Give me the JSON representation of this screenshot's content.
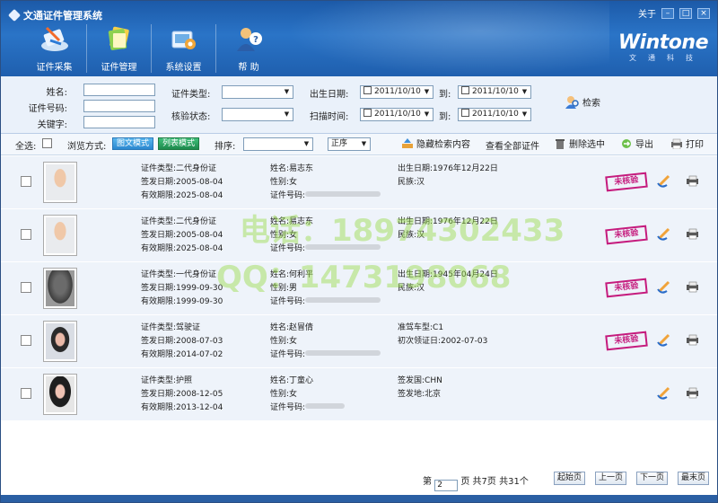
{
  "app": {
    "title": "文通证件管理系统",
    "about": "关于",
    "logo": "Wintone",
    "logo_sub": "文通科技"
  },
  "toolbar": {
    "items": [
      {
        "label": "证件采集",
        "icon": "scanner-icon"
      },
      {
        "label": "证件管理",
        "icon": "documents-icon"
      },
      {
        "label": "系统设置",
        "icon": "settings-icon"
      },
      {
        "label": "帮 助",
        "icon": "help-user-icon"
      }
    ]
  },
  "search": {
    "name_label": "姓名:",
    "idno_label": "证件号码:",
    "keyword_label": "关键字:",
    "type_label": "证件类型:",
    "verify_label": "核验状态:",
    "birth_label": "出生日期:",
    "scan_label": "扫描时间:",
    "to": "到:",
    "birth_from": "2011/10/10",
    "birth_to": "2011/10/10",
    "scan_from": "2011/10/10",
    "scan_to": "2011/10/10",
    "search_button": "检索"
  },
  "listbar": {
    "select_all": "全选:",
    "view_mode": "浏览方式:",
    "image_mode": "图文模式",
    "list_mode": "列表模式",
    "sort": "排序:",
    "order": "正序",
    "hide_search": "隐藏检索内容",
    "view_all": "查看全部证件",
    "delete_selected": "删除选中",
    "export": "导出",
    "print": "打印"
  },
  "records": [
    {
      "col1": [
        "证件类型:二代身份证",
        "签发日期:2005-08-04",
        "有效期限:2025-08-04"
      ],
      "col2": [
        "姓名:易志东",
        "性别:女",
        "证件号码:"
      ],
      "col3": [
        "出生日期:1976年12月22日",
        "民族:汉"
      ],
      "status": "未核验",
      "photo": "light"
    },
    {
      "col1": [
        "证件类型:二代身份证",
        "签发日期:2005-08-04",
        "有效期限:2025-08-04"
      ],
      "col2": [
        "姓名:易志东",
        "性别:女",
        "证件号码:"
      ],
      "col3": [
        "出生日期:1976年12月22日",
        "民族:汉"
      ],
      "status": "未核验",
      "photo": "light"
    },
    {
      "col1": [
        "证件类型:一代身份证",
        "签发日期:1999-09-30",
        "有效期限:1999-09-30"
      ],
      "col2": [
        "姓名:何利平",
        "性别:男",
        "证件号码:"
      ],
      "col3": [
        "出生日期:1945年04月24日",
        "民族:汉"
      ],
      "status": "未核验",
      "photo": "gray"
    },
    {
      "col1": [
        "证件类型:驾驶证",
        "签发日期:2008-07-03",
        "有效期限:2014-07-02"
      ],
      "col2": [
        "姓名:赵冒倩",
        "性别:女",
        "证件号码:"
      ],
      "col3": [
        "准驾车型:C1",
        "初次领证日:2002-07-03"
      ],
      "status": "未核验",
      "photo": "dark"
    },
    {
      "col1": [
        "证件类型:护照",
        "签发日期:2008-12-05",
        "有效期限:2013-12-04"
      ],
      "col2": [
        "姓名:丁童心",
        "性别:女",
        "证件号码:"
      ],
      "col3": [
        "签发国:CHN",
        "签发地:北京"
      ],
      "status": "",
      "photo": "hair"
    }
  ],
  "pager": {
    "page_prefix": "第",
    "page_value": "2",
    "page_suffix": "页 共7页 共31个",
    "first": "起始页",
    "prev": "上一页",
    "next": "下一页",
    "last": "最末页"
  },
  "watermark": {
    "line1": "电话：18974302433",
    "line2": "QQ：1473198068"
  }
}
